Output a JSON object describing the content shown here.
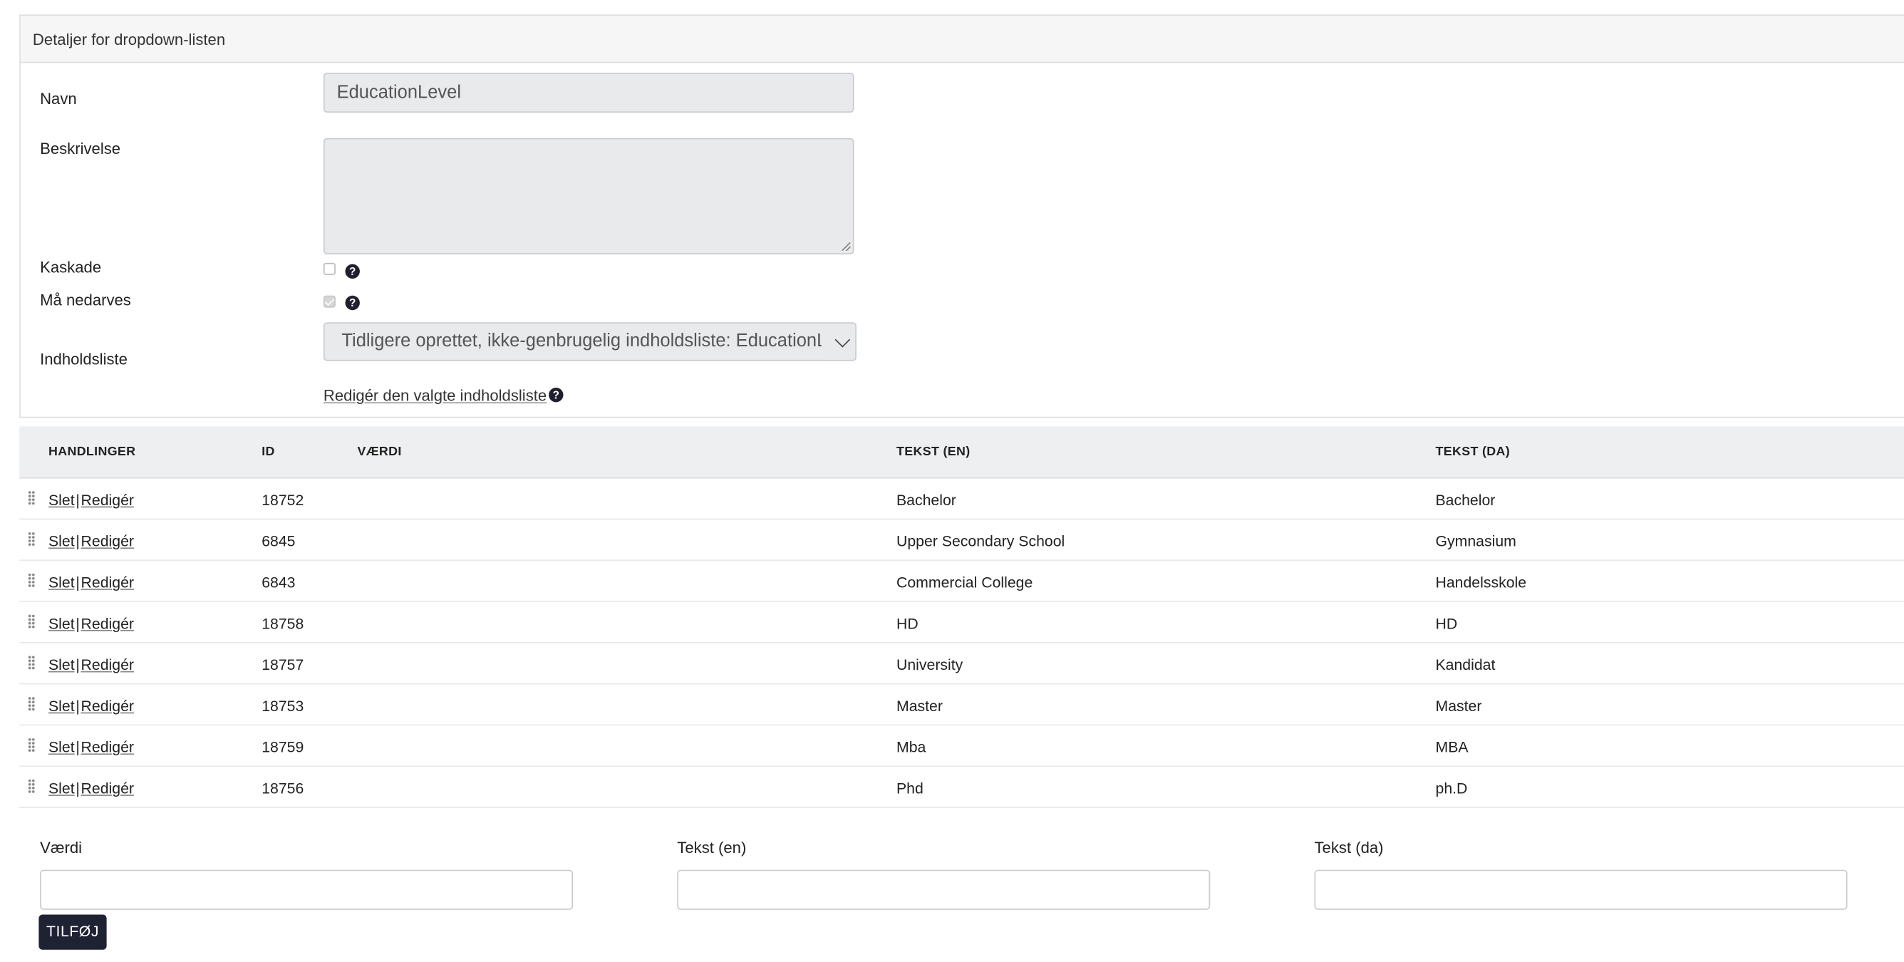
{
  "panel": {
    "title": "Detaljer for dropdown-listen",
    "name_label": "Navn",
    "name_value": "EducationLevel",
    "description_label": "Beskrivelse",
    "description_value": "",
    "cascade_label": "Kaskade",
    "cascade_checked": false,
    "inherit_label": "Må nedarves",
    "inherit_checked": true,
    "content_list_label": "Indholdsliste",
    "content_list_value": "Tidligere oprettet, ikke-genbrugelig indholdsliste: EducationLevel",
    "edit_content_list_link": "Redigér den valgte indholdsliste",
    "help_glyph": "?"
  },
  "table": {
    "headers": {
      "actions": "HANDLINGER",
      "id": "ID",
      "value": "VÆRDI",
      "text_en": "TEKST (EN)",
      "text_da": "TEKST (DA)"
    },
    "delete_label": "Slet",
    "separator": "|",
    "edit_label": "Redigér",
    "rows": [
      {
        "id": "18752",
        "value": "",
        "text_en": "Bachelor",
        "text_da": "Bachelor"
      },
      {
        "id": "6845",
        "value": "",
        "text_en": "Upper Secondary School",
        "text_da": "Gymnasium"
      },
      {
        "id": "6843",
        "value": "",
        "text_en": "Commercial College",
        "text_da": "Handelsskole"
      },
      {
        "id": "18758",
        "value": "",
        "text_en": "HD",
        "text_da": "HD"
      },
      {
        "id": "18757",
        "value": "",
        "text_en": "University",
        "text_da": "Kandidat"
      },
      {
        "id": "18753",
        "value": "",
        "text_en": "Master",
        "text_da": "Master"
      },
      {
        "id": "18759",
        "value": "",
        "text_en": "Mba",
        "text_da": "MBA"
      },
      {
        "id": "18756",
        "value": "",
        "text_en": "Phd",
        "text_da": "ph.D"
      }
    ]
  },
  "add_form": {
    "value_label": "Værdi",
    "text_en_label": "Tekst (en)",
    "text_da_label": "Tekst (da)",
    "value_input": "",
    "text_en_input": "",
    "text_da_input": "",
    "add_button": "TILFØJ"
  },
  "colors": {
    "button_bg": "#1f2233",
    "field_bg": "#e9eaec",
    "header_bg": "#eeeff1"
  }
}
